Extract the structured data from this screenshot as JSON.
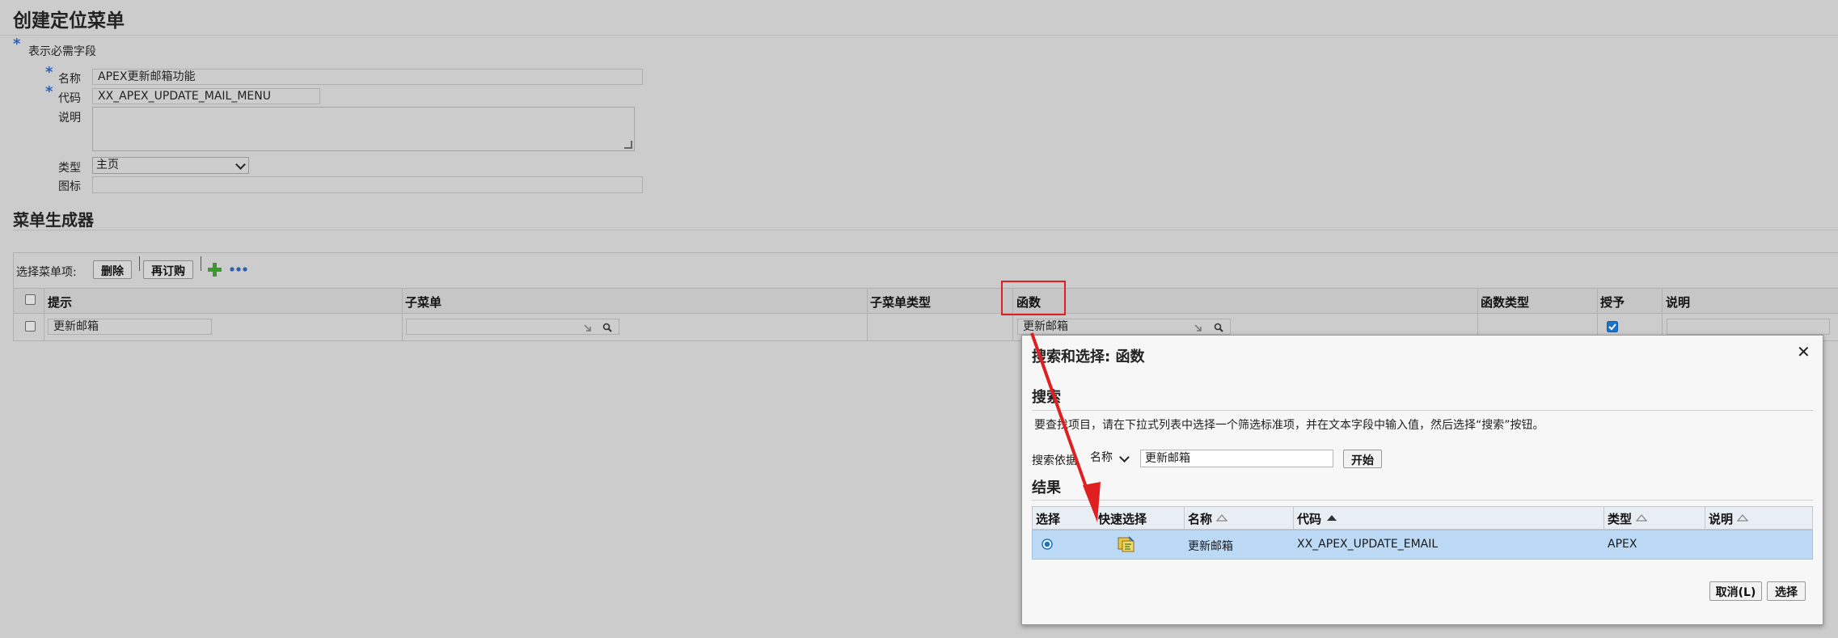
{
  "page": {
    "title": "创建定位菜单",
    "required_note_star": "*",
    "required_note": "表示必需字段"
  },
  "form": {
    "name_label": "名称",
    "name_value": "APEX更新邮箱功能",
    "code_label": "代码",
    "code_value": "XX_APEX_UPDATE_MAIL_MENU",
    "desc_label": "说明",
    "desc_value": "",
    "type_label": "类型",
    "type_value": "主页",
    "icon_label": "图标",
    "icon_value": "",
    "star": "*"
  },
  "builder": {
    "title": "菜单生成器",
    "select_label": "选择菜单项:",
    "delete_btn": "删除",
    "reorder_btn": "再订购",
    "columns": [
      "提示",
      "子菜单",
      "子菜单类型",
      "函数",
      "函数类型",
      "授予",
      "说明"
    ],
    "row": {
      "prompt": "更新邮箱",
      "submenu": "",
      "submenu_type": "",
      "function": "更新邮箱",
      "function_type": "",
      "granted": true,
      "desc": ""
    }
  },
  "dialog": {
    "title": "搜索和选择: 函数",
    "close": "✕",
    "search_section": "搜索",
    "instructions": "要查找项目，请在下拉式列表中选择一个筛选标准项，并在文本字段中输入值，然后选择“搜索”按钮。",
    "search_by_label": "搜索依据",
    "search_by_value": "名称",
    "search_text": "更新邮箱",
    "go_btn": "开始",
    "results_section": "结果",
    "columns": [
      "选择",
      "快速选择",
      "名称",
      "代码",
      "类型",
      "说明"
    ],
    "result": {
      "name": "更新邮箱",
      "code": "XX_APEX_UPDATE_EMAIL",
      "type": "APEX",
      "desc": ""
    },
    "cancel_btn": "取消(L)",
    "select_btn": "选择"
  },
  "colors": {
    "background": "#cccccc",
    "annotation_red": "#e02020",
    "selected_row": "#bcdaf6",
    "required_star": "#2f5fb5"
  },
  "icons": [
    "add-icon",
    "more-icon",
    "search-icon",
    "clear-icon",
    "quick-select-icon",
    "close-icon",
    "sort-asc-icon",
    "sort-none-icon"
  ]
}
